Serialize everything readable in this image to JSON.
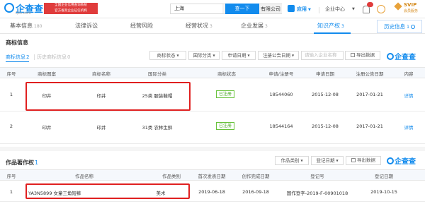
{
  "header": {
    "logo_text": "企查查",
    "logo_url": "Qcc.com",
    "slogan_line1": "全国企业信用查询系统",
    "slogan_line2": "官方备案企业征信机构",
    "search_value": "上海",
    "search_value_suffix": "有限公司",
    "search_button": "查一下",
    "menu_apps": "应用",
    "menu_enterprise": "企业中心",
    "vip_label": "SVIP",
    "vip_sub": "会员服务"
  },
  "tabs": [
    {
      "label": "基本信息",
      "count": "180"
    },
    {
      "label": "法律诉讼",
      "count": ""
    },
    {
      "label": "经营风险",
      "count": ""
    },
    {
      "label": "经营状况",
      "count": "3"
    },
    {
      "label": "企业发展",
      "count": "3"
    },
    {
      "label": "知识产权",
      "count": "3"
    },
    {
      "label": "历史信息",
      "count": "1"
    }
  ],
  "trademark": {
    "title": "商标信息",
    "subtab_active": "商标信息",
    "subtab_active_count": "2",
    "subtab_other": "历史商标信息",
    "subtab_other_count": "0",
    "filters": [
      "商标状态",
      "国际分类",
      "申请日期",
      "注册公告日期"
    ],
    "search_placeholder": "请输入企业名称",
    "export_label": "导出数据",
    "watermark": "企查查",
    "columns": [
      "序号",
      "商标图案",
      "商标名称",
      "国际分类",
      "商标状态",
      "申请/注册号",
      "申请日期",
      "注册公告日期",
      "内容"
    ],
    "rows": [
      {
        "index": "1",
        "image_text": "印井",
        "name": "印井",
        "class": "25类 服装鞋帽",
        "status": "已注册",
        "reg_no": "18544060",
        "apply_date": "2015-12-08",
        "pub_date": "2017-01-21",
        "action": "详情"
      },
      {
        "index": "2",
        "image_text": "印井",
        "name": "印井",
        "class": "31类 农林生鲜",
        "status": "已注册",
        "reg_no": "18544164",
        "apply_date": "2015-12-08",
        "pub_date": "2017-01-21",
        "action": "详情"
      }
    ]
  },
  "copyright": {
    "title": "作品著作权",
    "count": "1",
    "filters": [
      "作品类别",
      "登记日期"
    ],
    "export_label": "导出数据",
    "watermark": "企查查",
    "columns": [
      "序号",
      "作品名称",
      "作品类别",
      "首次发表日期",
      "创作完成日期",
      "登记号",
      "登记日期"
    ],
    "rows": [
      {
        "index": "1",
        "name": "YA3N5899 女童三角短裤",
        "category": "美术",
        "first_pub": "2019-06-18",
        "completed": "2016-09-18",
        "reg_no": "国作登字-2019-F-00901018",
        "reg_date": "2019-10-15"
      }
    ]
  },
  "colors": {
    "accent": "#128bed",
    "highlight": "#e02020",
    "status_green": "#67c23a"
  }
}
